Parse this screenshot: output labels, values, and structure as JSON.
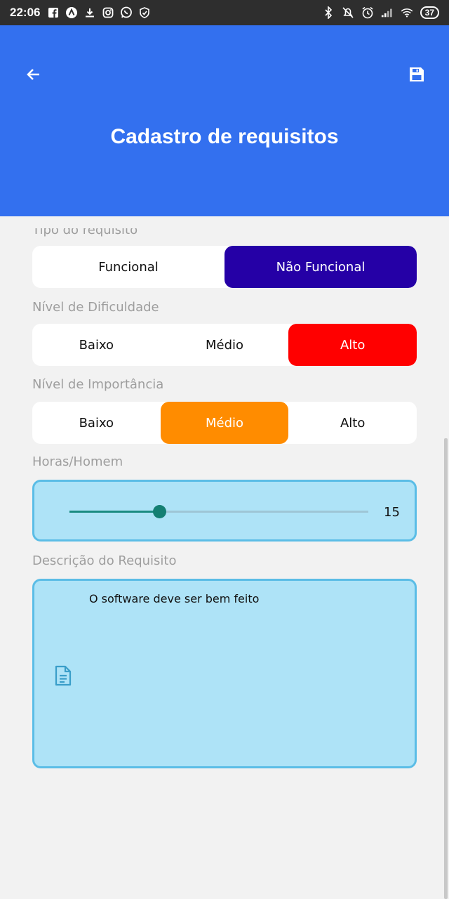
{
  "status_bar": {
    "time": "22:06",
    "left_icons": [
      "facebook-icon",
      "app-icon",
      "download-icon",
      "instagram-icon",
      "whatsapp-icon",
      "shield-icon"
    ],
    "right_icons": [
      "bluetooth-icon",
      "mute-icon",
      "alarm-icon",
      "signal-icon",
      "wifi-icon"
    ],
    "battery": "37"
  },
  "header": {
    "title": "Cadastro de requisitos",
    "background_color": "#3370ef"
  },
  "tipo": {
    "label": "Tipo do requisito",
    "options": [
      "Funcional",
      "Não Funcional"
    ],
    "selected": "Não Funcional",
    "selected_color": "#2500a6"
  },
  "dificuldade": {
    "label": "Nível de Dificuldade",
    "options": [
      "Baixo",
      "Médio",
      "Alto"
    ],
    "selected": "Alto",
    "selected_color": "#ff0000"
  },
  "importancia": {
    "label": "Nível de Importância",
    "options": [
      "Baixo",
      "Médio",
      "Alto"
    ],
    "selected": "Médio",
    "selected_color": "#ff8c00"
  },
  "horas": {
    "label": "Horas/Homem",
    "value": "15",
    "fraction": 0.3
  },
  "descricao": {
    "label": "Descrição do Requisito",
    "value": "O software deve ser bem feito"
  }
}
